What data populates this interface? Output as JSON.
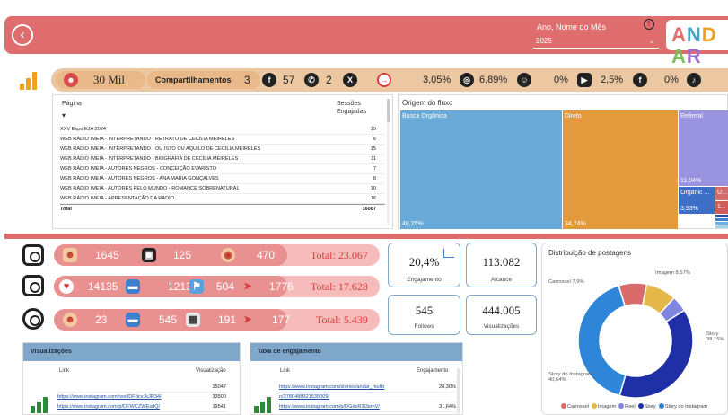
{
  "header": {
    "filter_label": "Ano, Nome do Mês",
    "filter_value": "2025",
    "info_icon": "info-icon",
    "logo_letters": [
      "A",
      "N",
      "D",
      "A",
      "R"
    ],
    "logo_colors": [
      "#e06d6d",
      "#4aa3c9",
      "#f2a020",
      "#7bbf5a",
      "#a06dc9"
    ]
  },
  "stats": {
    "reach": "30 Mil",
    "shares_label": "Compartilhamentos",
    "facebook": "3",
    "whatsapp": "57",
    "x": "2",
    "pct_1": "3,05%",
    "pct_2": "6,89%",
    "pct_3": "0%",
    "pct_4": "2,5%",
    "pct_5": "0%"
  },
  "table": {
    "col_page": "Página",
    "col_sessions_1": "Sessões",
    "col_sessions_2": "Engajadas",
    "rows": [
      {
        "page": "XXV Expo EJA 2024",
        "value": "19"
      },
      {
        "page": "WEB RÁDIO IMEIA - INTERPRETANDO - RETRATO DE CECÍLIA MEIRELES",
        "value": "6"
      },
      {
        "page": "WEB RÁDIO IMEIA - INTERPRETANDO - OU ISTO OU AQUILO DE CECÍLIA MEIRELES",
        "value": "15"
      },
      {
        "page": "WEB RÁDIO IMEIA - INTERPRETANDO - BIOGRAFIA DE CECÍLIA MEIRELES",
        "value": "11"
      },
      {
        "page": "WEB RÁDIO IMEIA - AUTORES NEGROS - CONCEIÇÃO EVARISTO",
        "value": "7"
      },
      {
        "page": "WEB RÁDIO IMEIA - AUTORES NEGROS - ANA MARIA GONÇALVES",
        "value": "8"
      },
      {
        "page": "WEB RÁDIO IMEIA - AUTORES PELO MUNDO - ROMANCE SOBRENATURAL",
        "value": "10"
      },
      {
        "page": "WEB RÁDIO IMEIA - APRESENTAÇÃO DA RÁDIO",
        "value": "16"
      }
    ],
    "total_label": "Total",
    "total_value": "16067"
  },
  "treemap": {
    "title": "Origem do fluxo",
    "cells": [
      {
        "label": "Busca Orgânica",
        "pct": "48,25%",
        "color": "#6aaad9"
      },
      {
        "label": "Direto",
        "pct": "34,74%",
        "color": "#e39a3c"
      },
      {
        "label": "Referral",
        "pct": "11,04%",
        "color": "#9a93e0"
      },
      {
        "label": "Organic ...",
        "pct": "3,93%",
        "color": "#3d6fc7"
      },
      {
        "label": "U...",
        "pct": "",
        "color": "#d46b6b"
      },
      {
        "label": "1...",
        "pct": "",
        "color": "#cf5b5b"
      }
    ]
  },
  "instagram": {
    "v1": "1645",
    "v2": "125",
    "v3": "470",
    "total": "Total: 23.067"
  },
  "facebook_row": {
    "v1": "14135",
    "v2": "1213",
    "v3": "504",
    "v4": "1776",
    "total": "Total: 17.628"
  },
  "other_row": {
    "v1": "23",
    "v2": "545",
    "v3": "191",
    "v4": "177",
    "total": "Total: 5.439"
  },
  "kpis": {
    "engagement_value": "20,4%",
    "engagement_label": "Engajamento",
    "reach_value": "113.082",
    "reach_label": "Alcance",
    "follows_value": "545",
    "follows_label": "Follows",
    "views_value": "444.005",
    "views_label": "Visualizações"
  },
  "donut": {
    "title": "Distribuição de postagens",
    "slices": [
      {
        "name": "Carrossel",
        "pct": 7.9,
        "label": "Carrossel 7,9%",
        "color": "#d96b6b"
      },
      {
        "name": "Imagem",
        "pct": 8.57,
        "label": "Imagem 8,57%",
        "color": "#e6b84a"
      },
      {
        "name": "Reel",
        "pct": 4.5,
        "label": "",
        "color": "#7e86e0"
      },
      {
        "name": "Story",
        "pct": 38.15,
        "label": "Story 38,15%",
        "color": "#1f2fa5"
      },
      {
        "name": "Story do Instagram",
        "pct": 40.64,
        "label": "Story do Instagram 40,64%",
        "color": "#2f86d8"
      }
    ],
    "legend": [
      "Carrossel",
      "Imagem",
      "Reel",
      "Story",
      "Story do Instagram"
    ]
  },
  "views_table": {
    "title": "Visualizações",
    "col_link": "Link",
    "col_value": "Visualização",
    "rows": [
      {
        "link": "",
        "value": "35047"
      },
      {
        "link": "https://www.instagram.com/reel/DFdcvJkJR34/",
        "value": "33500"
      },
      {
        "link": "https://www.instagram.com/p/DFWCZWEsdQ/",
        "value": "19541"
      }
    ]
  },
  "engagement_table": {
    "title": "Taxa de engajamento",
    "col_link": "Link",
    "col_value": "Engajamento",
    "rows": [
      {
        "link": "https://www.instagram.com/stories/andar_multir",
        "value": "28,30%"
      },
      {
        "link": "n/3780488321535009/",
        "value": ""
      },
      {
        "link": "https://www.instagram.com/p/DGdsR3l3emV/",
        "value": "31,64%"
      }
    ]
  }
}
